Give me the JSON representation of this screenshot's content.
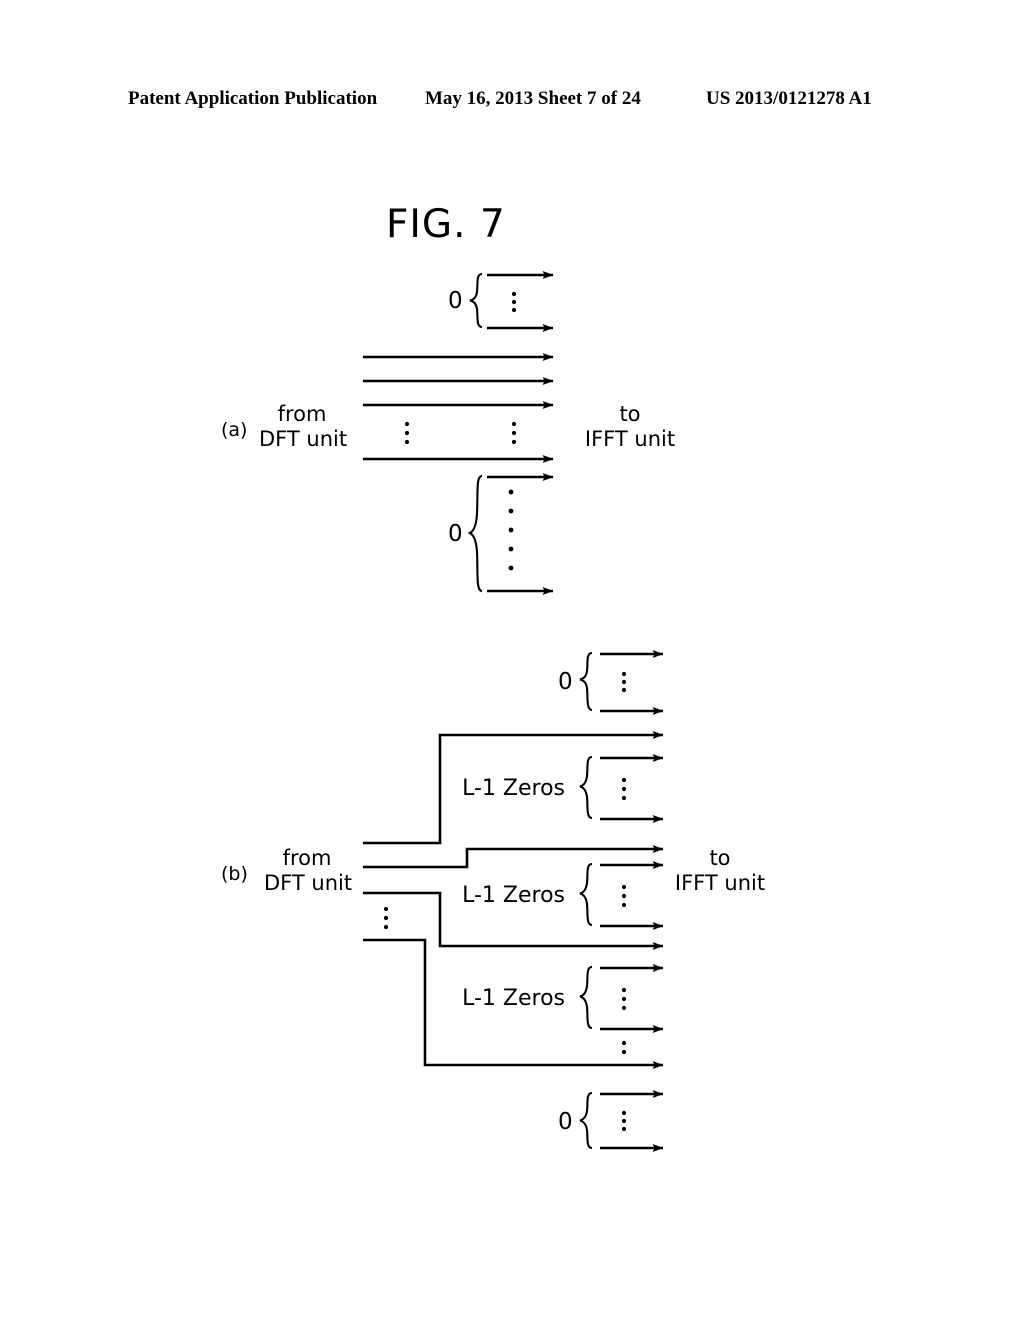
{
  "header": {
    "publication": "Patent Application Publication",
    "date_sheet": "May 16, 2013  Sheet 7 of 24",
    "doc_number": "US 2013/0121278 A1"
  },
  "figure": {
    "title": "FIG. 7",
    "line_color": "#000000",
    "background": "#ffffff"
  },
  "panels": [
    {
      "id": "a",
      "label": "(a)",
      "source_label": "from\nDFT unit",
      "source_line1": "from",
      "source_line2": "DFT unit",
      "dest_line1": "to",
      "dest_line2": "IFFT unit",
      "groups": [
        {
          "name": "top-zero-group",
          "label": "0",
          "arrows": 2,
          "vertical_dots": 3
        },
        {
          "name": "data-arrows",
          "label": "",
          "arrows": 4,
          "vertical_dots": 3
        },
        {
          "name": "bottom-zero-group",
          "label": "0",
          "arrows": 2,
          "vertical_dots": 6
        }
      ]
    },
    {
      "id": "b",
      "label": "(b)",
      "source_line1": "from",
      "source_line2": "DFT unit",
      "dest_line1": "to",
      "dest_line2": "IFFT unit",
      "zero_label": "0",
      "zeros_label": "L-1 Zeros",
      "groups": [
        {
          "name": "top-zero-group",
          "label": "0",
          "arrows": 2,
          "vertical_dots": 3
        },
        {
          "name": "zeros-group-1",
          "label": "L-1 Zeros",
          "arrows": 2,
          "vertical_dots": 3
        },
        {
          "name": "zeros-group-2",
          "label": "L-1 Zeros",
          "arrows": 2,
          "vertical_dots": 3
        },
        {
          "name": "zeros-group-3",
          "label": "L-1 Zeros",
          "arrows": 2,
          "vertical_dots": 3
        },
        {
          "name": "bottom-zero-group",
          "label": "0",
          "arrows": 2,
          "vertical_dots": 3
        }
      ]
    }
  ]
}
